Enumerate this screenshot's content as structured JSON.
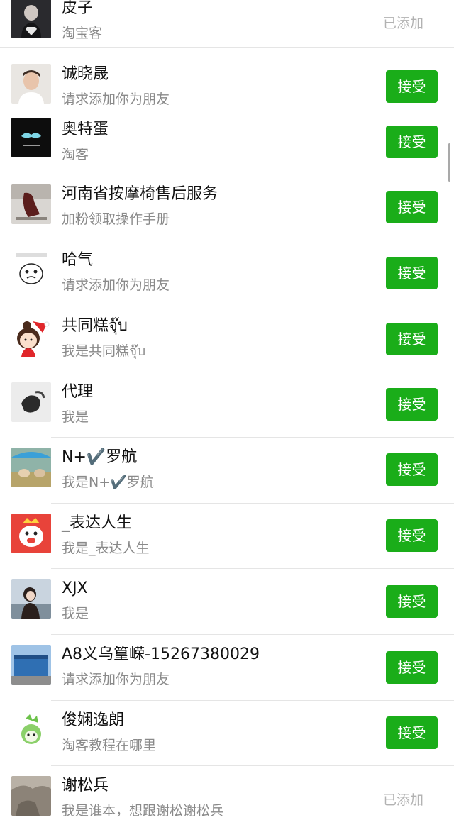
{
  "labels": {
    "accept": "接受",
    "added": "已添加"
  },
  "requests": [
    {
      "name": "皮子",
      "message": "淘宝客",
      "status": "已添加",
      "avatar": "superman-shirt-avatar"
    },
    {
      "name": "诚晓晟",
      "message": "请求添加你为朋友",
      "status": "接受",
      "avatar": "person-photo-avatar"
    },
    {
      "name": "奥特蛋",
      "message": "淘客",
      "status": "接受",
      "avatar": "dark-logo-avatar"
    },
    {
      "name": "河南省按摩椅售后服务",
      "message": "加粉领取操作手册",
      "status": "接受",
      "avatar": "massage-chair-avatar"
    },
    {
      "name": "哈气",
      "message": "请求添加你为朋友",
      "status": "接受",
      "avatar": "cartoon-face-avatar"
    },
    {
      "name": "共同糕จุ๊บ",
      "message": "我是共同糕จุ๊บ",
      "status": "接受",
      "avatar": "christmas-girl-avatar"
    },
    {
      "name": "代理",
      "message": "我是",
      "status": "接受",
      "avatar": "object-photo-avatar"
    },
    {
      "name": "N+✔️罗航",
      "message": "我是N+✔️罗航",
      "status": "接受",
      "avatar": "umbrella-pets-avatar"
    },
    {
      "name": "_表达人生",
      "message": "我是_表达人生",
      "status": "接受",
      "avatar": "red-cartoon-avatar"
    },
    {
      "name": "XJX",
      "message": "我是",
      "status": "接受",
      "avatar": "girl-photo-avatar"
    },
    {
      "name": "A8义乌篁嵘-15267380029",
      "message": "请求添加你为朋友",
      "status": "接受",
      "avatar": "building-photo-avatar"
    },
    {
      "name": "俊娴逸朗",
      "message": "淘客教程在哪里",
      "status": "接受",
      "avatar": "green-cartoon-avatar"
    },
    {
      "name": "谢松兵",
      "message": "我是谁本，想跟谢松谢松兵",
      "status": "已添加",
      "avatar": "rock-photo-avatar"
    }
  ]
}
